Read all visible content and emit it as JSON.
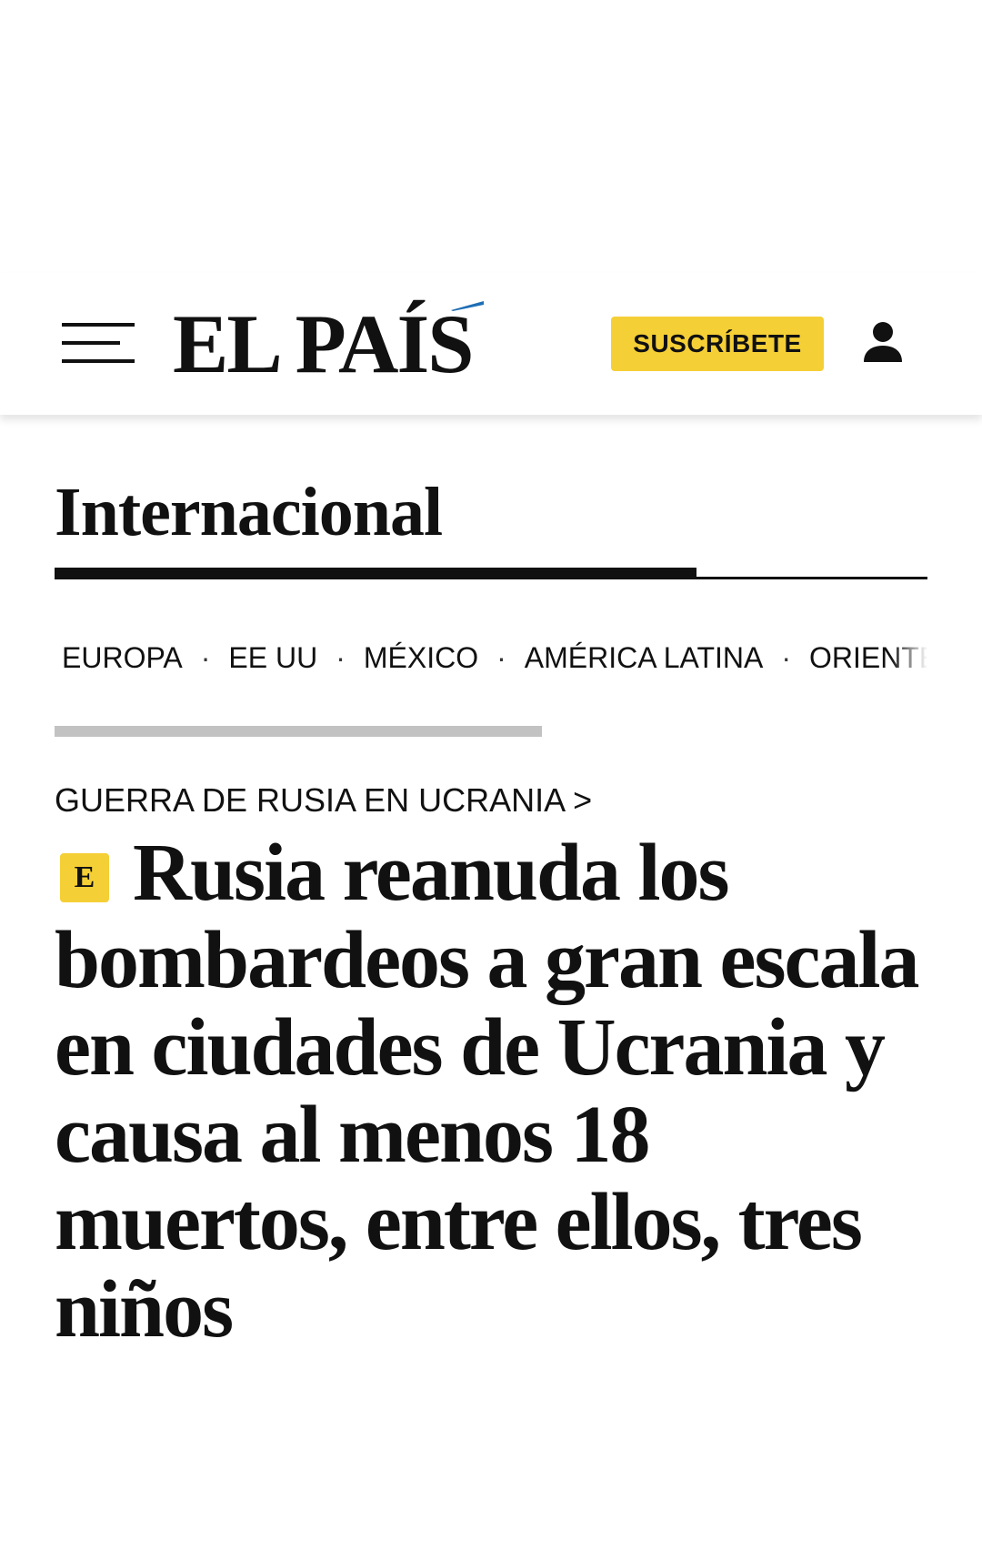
{
  "header": {
    "logo_text": "EL PAÍS",
    "subscribe_label": "SUSCRÍBETE",
    "accent_color": "#F5CF36",
    "logo_accent_color": "#1E6EB5"
  },
  "section": {
    "title": "Internacional"
  },
  "subnav": {
    "items": [
      "EUROPA",
      "EE UU",
      "MÉXICO",
      "AMÉRICA LATINA",
      "ORIENTE PR"
    ],
    "separator": "·"
  },
  "article": {
    "kicker": "GUERRA DE RUSIA EN UCRANIA >",
    "badge": "E",
    "headline": "Rusia reanuda los bombardeos a gran escala en ciudades de Ucrania y causa al menos 18 muertos, entre ellos, tres niños"
  }
}
